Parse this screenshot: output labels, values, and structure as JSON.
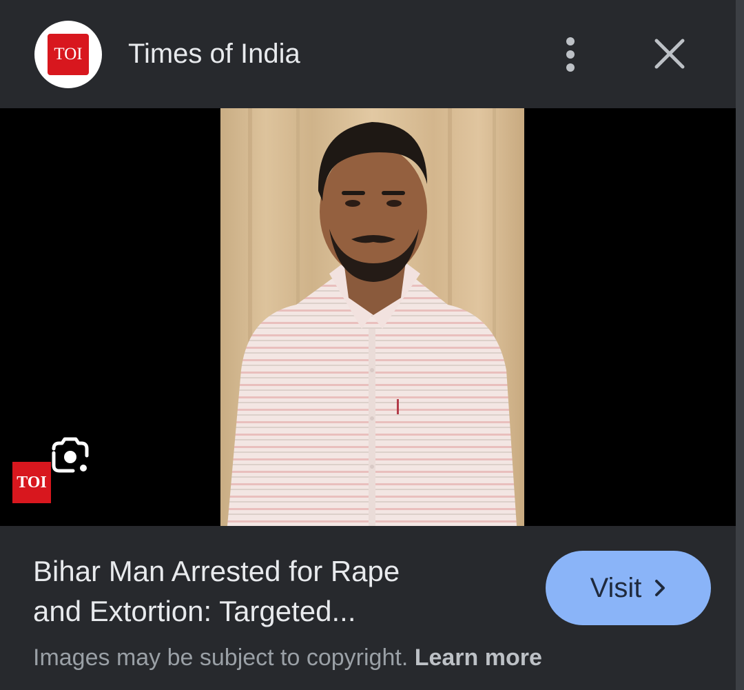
{
  "header": {
    "logo_text": "TOI",
    "site_name": "Times of India",
    "more_icon": "more-vert-icon",
    "close_icon": "close-icon"
  },
  "image": {
    "lens_icon": "google-lens-icon",
    "watermark_text": "TOI"
  },
  "footer": {
    "headline_line1": "Bihar Man Arrested for Rape",
    "headline_line2": "and Extortion: Targeted...",
    "visit_label": "Visit",
    "visit_icon": "chevron-right-icon",
    "copyright_text": "Images may be subject to copyright.",
    "learn_more_label": "Learn more"
  },
  "colors": {
    "background": "#27292d",
    "accent": "#8ab4f8",
    "brand_red": "#d8171e"
  }
}
